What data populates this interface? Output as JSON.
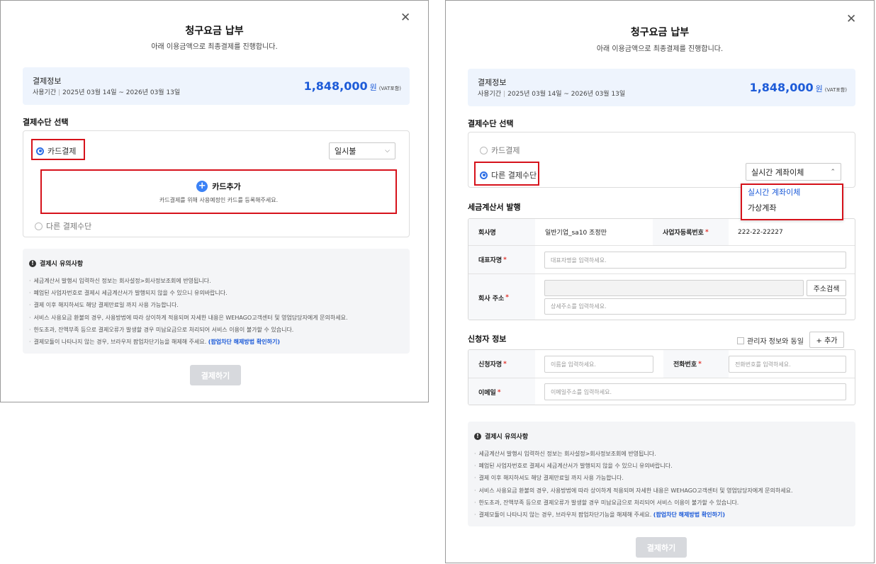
{
  "common": {
    "title": "청구요금 납부",
    "subtitle": "아래 이용금액으로 최종결제를 진행합니다.",
    "close_icon": "✕",
    "payment_info": {
      "label": "결제정보",
      "period_label": "사용기간",
      "period_value": "2025년 03월 14일 ~ 2026년 03월 13일",
      "amount": "1,848,000",
      "currency": "원",
      "vat": "(VAT포함)"
    },
    "method_section_title": "결제수단 선택",
    "method_card": "카드결제",
    "method_other": "다른 결제수단",
    "notice": {
      "title": "결제시 유의사항",
      "items": [
        "세금계산서 발행시 입력하신 정보는 회사설정>회사정보조회에 반영됩니다.",
        "폐업된 사업자번호로 결제시 세금계산서가 발행되지 않을 수 있으니 유의바랍니다.",
        "결제 이후 해지하셔도 해당 결제만료일 까지 사용 가능합니다.",
        "서비스 사용요금 환불의 경우, 사용방법에 따라 상이하게 적용되며 자세한 내용은 WEHAGO고객센터 및 영업담당자에게 문의하세요.",
        "한도초과, 잔액부족 등으로 결제오류가 발생할 경우 미납요금으로 처리되어 서비스 이용이 불가할 수 있습니다."
      ],
      "last_item": "결제모듈이 나타나지 않는 경우, 브라우저 팝업차단기능을 해제해 주세요.",
      "last_link": "(팝업차단 해제방법 확인하기)"
    },
    "submit_label": "결제하기",
    "accent_color": "#1d5bd8",
    "highlight_color": "#d6121b"
  },
  "left": {
    "installment": "일시불",
    "card_add_label": "카드추가",
    "card_add_desc": "카드결제를 위해 사용예정인 카드를 등록해주세요."
  },
  "right": {
    "selected_method": "실시간 계좌이체",
    "dropdown_options": [
      "실시간 계좌이체",
      "가상계좌"
    ],
    "tax_section_title": "세금계산서 발행",
    "tax": {
      "company_label": "회사명",
      "company_value": "일반기업_sa10 조정만",
      "bizno_label": "사업자등록번호",
      "bizno_value": "222-22-22227",
      "ceo_label": "대표자명",
      "ceo_placeholder": "대표자명을 입력하세요.",
      "address_label": "회사 주소",
      "address_search": "주소검색",
      "address_detail_placeholder": "상세주소를 입력하세요."
    },
    "applicant_section_title": "신청자 정보",
    "same_as_admin": "관리자 정보와 동일",
    "add_button": "+ 추가",
    "applicant": {
      "name_label": "신청자명",
      "name_placeholder": "이름을 입력하세요.",
      "phone_label": "전화번호",
      "phone_placeholder": "전화번호를 입력하세요.",
      "email_label": "이메일",
      "email_placeholder": "이메일주소를 입력하세요."
    }
  }
}
